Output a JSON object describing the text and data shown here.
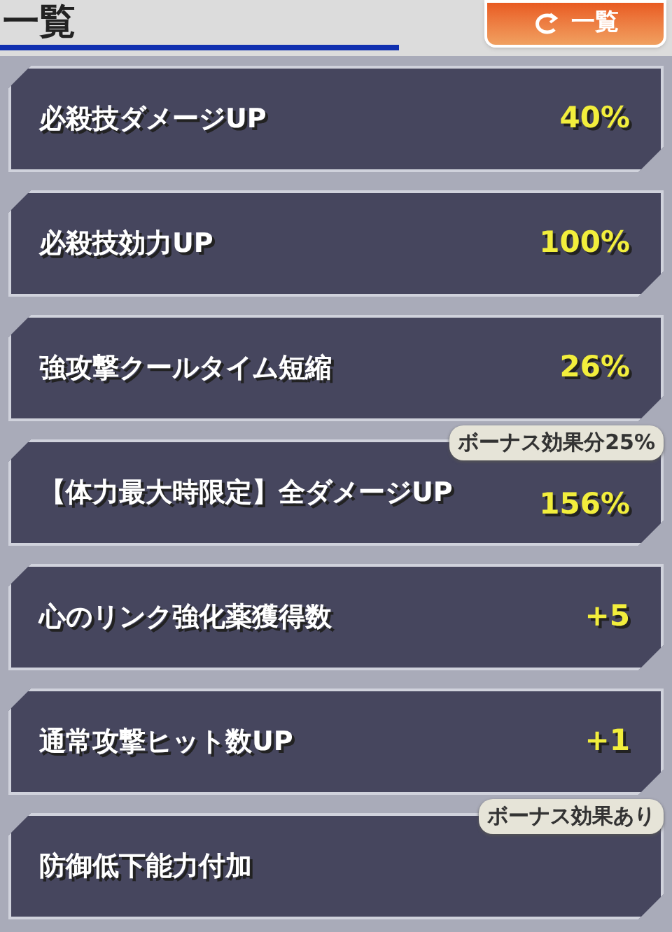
{
  "header": {
    "title": "一覧",
    "switch_button": {
      "label": "一覧"
    }
  },
  "effects": [
    {
      "name": "必殺技ダメージUP",
      "value": "40%"
    },
    {
      "name": "必殺技効力UP",
      "value": "100%"
    },
    {
      "name": "強攻撃クールタイム短縮",
      "value": "26%"
    },
    {
      "name": "【体力最大時限定】全ダメージUP",
      "value": "156%",
      "bonus": "ボーナス効果分25%"
    },
    {
      "name": "心のリンク強化薬獲得数",
      "value": "+5"
    },
    {
      "name": "通常攻撃ヒット数UP",
      "value": "+1"
    },
    {
      "name": "防御低下能力付加",
      "bonus": "ボーナス効果あり"
    }
  ]
}
